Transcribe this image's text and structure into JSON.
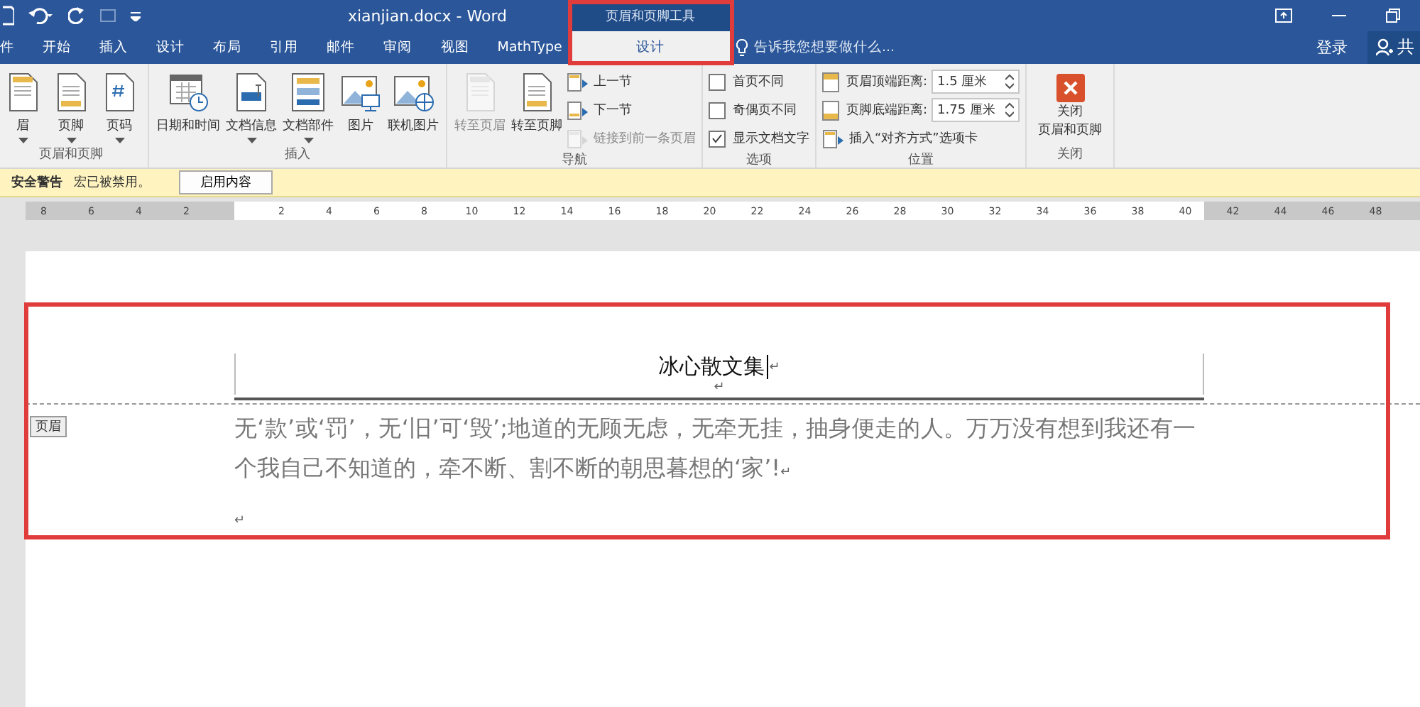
{
  "title_bar": {
    "title": "xianjian.docx - Word",
    "context_group": "页眉和页脚工具"
  },
  "tabs": [
    {
      "label": "件",
      "selected": false,
      "kind": "normal"
    },
    {
      "label": "开始",
      "selected": false,
      "kind": "normal"
    },
    {
      "label": "插入",
      "selected": false,
      "kind": "normal"
    },
    {
      "label": "设计",
      "selected": false,
      "kind": "normal"
    },
    {
      "label": "布局",
      "selected": false,
      "kind": "normal"
    },
    {
      "label": "引用",
      "selected": false,
      "kind": "normal"
    },
    {
      "label": "邮件",
      "selected": false,
      "kind": "normal"
    },
    {
      "label": "审阅",
      "selected": false,
      "kind": "normal"
    },
    {
      "label": "视图",
      "selected": false,
      "kind": "normal"
    },
    {
      "label": "MathType",
      "selected": false,
      "kind": "normal"
    },
    {
      "label": "设计",
      "selected": true,
      "kind": "contextual"
    }
  ],
  "tell_me": {
    "placeholder": "告诉我您想要做什么..."
  },
  "sign_in": "登录",
  "share": "共",
  "ribbon": [
    {
      "label": "页眉和页脚",
      "items": [
        {
          "kind": "large",
          "label": "眉",
          "dropdown": true,
          "disabled": false
        },
        {
          "kind": "large",
          "label": "页脚",
          "dropdown": true,
          "disabled": false
        },
        {
          "kind": "large",
          "label": "页码",
          "dropdown": true,
          "disabled": false
        }
      ]
    },
    {
      "label": "插入",
      "items": [
        {
          "kind": "large",
          "label": "日期和时间",
          "dropdown": false,
          "disabled": false
        },
        {
          "kind": "large",
          "label": "文档信息",
          "dropdown": true,
          "disabled": false
        },
        {
          "kind": "large",
          "label": "文档部件",
          "dropdown": true,
          "disabled": false
        },
        {
          "kind": "large",
          "label": "图片",
          "dropdown": false,
          "disabled": false
        },
        {
          "kind": "large",
          "label": "联机图片",
          "dropdown": false,
          "disabled": false
        }
      ]
    },
    {
      "label": "导航",
      "items": [
        {
          "kind": "large",
          "label": "转至页眉",
          "dropdown": false,
          "disabled": true
        },
        {
          "kind": "large",
          "label": "转至页脚",
          "dropdown": false,
          "disabled": false
        },
        {
          "kind": "small",
          "label": "上一节",
          "disabled": false
        },
        {
          "kind": "small",
          "label": "下一节",
          "disabled": false
        },
        {
          "kind": "small",
          "label": "链接到前一条页眉",
          "disabled": true
        }
      ]
    },
    {
      "label": "选项",
      "items": [
        {
          "kind": "checkbox",
          "label": "首页不同",
          "checked": false
        },
        {
          "kind": "checkbox",
          "label": "奇偶页不同",
          "checked": false
        },
        {
          "kind": "checkbox",
          "label": "显示文档文字",
          "checked": true
        }
      ]
    },
    {
      "label": "位置",
      "items": [
        {
          "kind": "spinner",
          "label": "页眉顶端距离:",
          "value": "1.5 厘米"
        },
        {
          "kind": "spinner",
          "label": "页脚底端距离:",
          "value": "1.75 厘米"
        },
        {
          "kind": "small",
          "label": "插入“对齐方式”选项卡",
          "disabled": false
        }
      ]
    },
    {
      "label": "关闭",
      "items": [
        {
          "kind": "close",
          "label_lines": [
            "关闭",
            "页眉和页脚"
          ]
        }
      ]
    }
  ],
  "security_bar": {
    "title": "安全警告",
    "message": "宏已被禁用。",
    "button": "启用内容"
  },
  "ruler": {
    "left_labels": [
      "8",
      "6",
      "4",
      "2"
    ],
    "right_labels": [
      "2",
      "4",
      "6",
      "8",
      "10",
      "12",
      "14",
      "16",
      "18",
      "20",
      "22",
      "24",
      "26",
      "28",
      "30",
      "32",
      "34",
      "36",
      "38",
      "40",
      "42",
      "44",
      "46",
      "48"
    ]
  },
  "document": {
    "header_tag": "页眉",
    "header_title": "冰心散文集",
    "header_title_mark": "↵",
    "header_empty_mark": "↵",
    "body": "无‘款’或‘罚’，无‘旧’可‘毁’;地道的无顾无虑，无牵无挂，抽身便走的人。万万没有想到我还有一个我自己不知道的，牵不断、割不断的朝思暮想的‘家’!",
    "body_mark": "↵",
    "empty_mark": "↵"
  }
}
